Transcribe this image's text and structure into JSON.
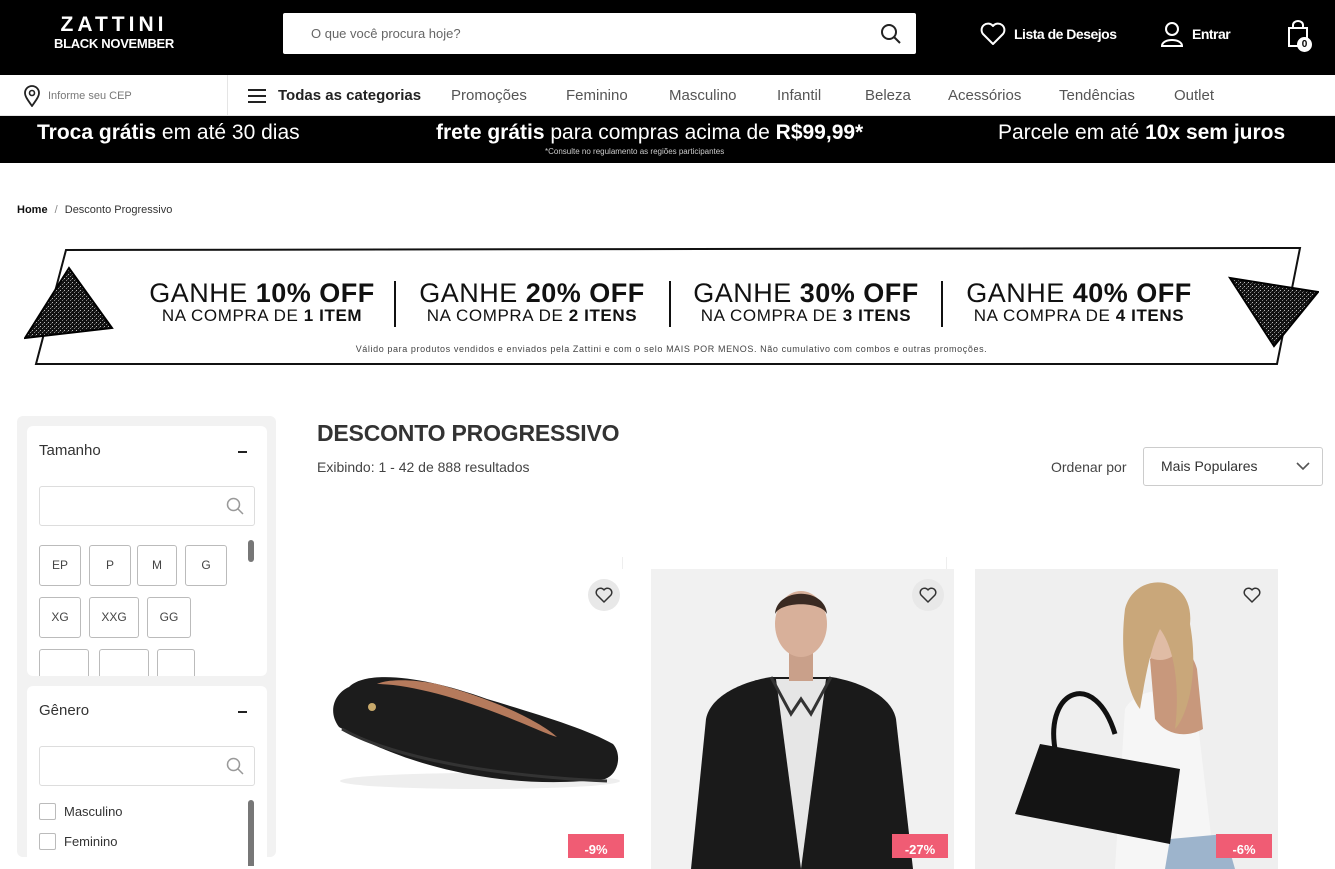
{
  "header": {
    "logo_line1": "ZATTINI",
    "logo_line2": "BLACK NOVEMBER",
    "search_placeholder": "O que você procura hoje?",
    "wishlist_label": "Lista de Desejos",
    "login_label": "Entrar",
    "cart_count": "0"
  },
  "nav": {
    "cep_placeholder": "Informe seu CEP",
    "all_categories": "Todas as categorias",
    "items": [
      "Promoções",
      "Feminino",
      "Masculino",
      "Infantil",
      "Beleza",
      "Acessórios",
      "Tendências",
      "Outlet"
    ]
  },
  "promo": {
    "exchange_bold": "Troca grátis",
    "exchange_rest": " em até 30 dias",
    "shipping_bold": "frete grátis",
    "shipping_mid": " para compras acima de ",
    "shipping_value": "R$99,99*",
    "shipping_note": "*Consulte no regulamento as regiões participantes",
    "installments_pre": "Parcele em até ",
    "installments_bold": "10x sem juros"
  },
  "breadcrumb": {
    "home": "Home",
    "separator": "/",
    "current": "Desconto Progressivo"
  },
  "banner": {
    "offers": [
      {
        "pre": "GANHE ",
        "pct": "10% OFF",
        "line2_pre": "NA COMPRA DE ",
        "line2_bold": "1 ITEM"
      },
      {
        "pre": "GANHE ",
        "pct": "20% OFF",
        "line2_pre": "NA COMPRA DE ",
        "line2_bold": "2 ITENS"
      },
      {
        "pre": "GANHE ",
        "pct": "30% OFF",
        "line2_pre": "NA COMPRA DE ",
        "line2_bold": "3 ITENS"
      },
      {
        "pre": "GANHE ",
        "pct": "40% OFF",
        "line2_pre": "NA COMPRA DE ",
        "line2_bold": "4 ITENS"
      }
    ],
    "note": "Válido para produtos vendidos e enviados pela Zattini e com o selo MAIS POR MENOS. Não cumulativo com combos e outras promoções."
  },
  "filters": {
    "size": {
      "title": "Tamanho",
      "options": [
        "EP",
        "P",
        "M",
        "G",
        "XG",
        "XXG",
        "GG"
      ]
    },
    "gender": {
      "title": "Gênero",
      "options": [
        "Masculino",
        "Feminino"
      ]
    }
  },
  "listing": {
    "title": "DESCONTO PROGRESSIVO",
    "results": "Exibindo: 1 - 42 de 888 resultados",
    "sort_label": "Ordenar por",
    "sort_value": "Mais Populares"
  },
  "products": [
    {
      "image": "black-flat-shoe",
      "discount": "-9%"
    },
    {
      "image": "man-leather-jacket",
      "discount": "-27%"
    },
    {
      "image": "woman-black-tote-bag",
      "discount": "-6%"
    }
  ],
  "colors": {
    "discount_badge": "#f05c74",
    "header_bg": "#000000"
  }
}
